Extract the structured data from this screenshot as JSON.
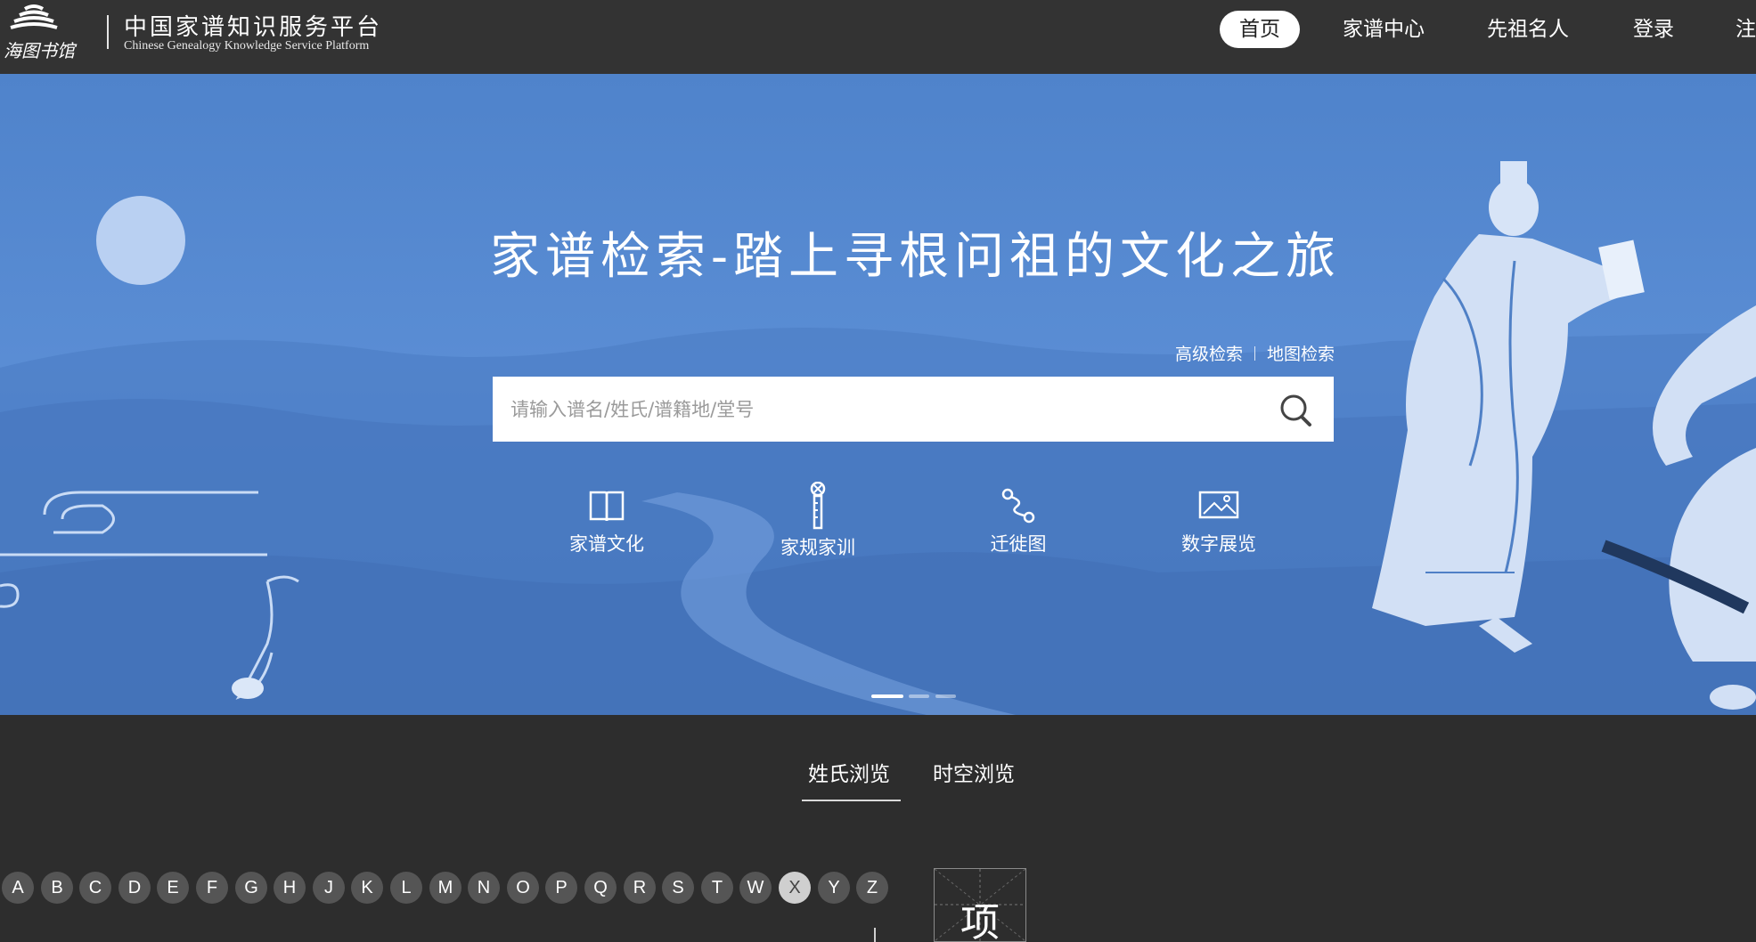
{
  "header": {
    "logo_text": "海图书馆",
    "site_title": "中国家谱知识服务平台",
    "site_subtitle": "Chinese Genealogy Knowledge Service Platform",
    "nav": [
      {
        "label": "首页",
        "active": true
      },
      {
        "label": "家谱中心"
      },
      {
        "label": "先祖名人"
      },
      {
        "label": "登录"
      },
      {
        "label": "注"
      }
    ]
  },
  "hero": {
    "title": "家谱检索-踏上寻根问祖的文化之旅",
    "advanced_search": "高级检索",
    "map_search": "地图检索",
    "search_placeholder": "请输入谱名/姓氏/谱籍地/堂号",
    "quick_links": [
      {
        "label": "家谱文化",
        "icon": "book-icon"
      },
      {
        "label": "家规家训",
        "icon": "scroll-icon"
      },
      {
        "label": "迁徙图",
        "icon": "route-icon"
      },
      {
        "label": "数字展览",
        "icon": "gallery-icon"
      }
    ],
    "carousel": {
      "slides": 3,
      "active": 1
    }
  },
  "browse": {
    "tabs": [
      {
        "label": "姓氏浏览",
        "active": true
      },
      {
        "label": "时空浏览"
      }
    ],
    "letters": [
      "A",
      "B",
      "C",
      "D",
      "E",
      "F",
      "G",
      "H",
      "J",
      "K",
      "L",
      "M",
      "N",
      "O",
      "P",
      "Q",
      "R",
      "S",
      "T",
      "W",
      "X",
      "Y",
      "Z"
    ],
    "selected_letter": "X",
    "surname_card": "项"
  },
  "colors": {
    "header_bg": "#333333",
    "hero_blue": "#5a8dd4",
    "page_bg": "#2d2d2d",
    "letter_bg": "#555555",
    "letter_selected_bg": "#cfcfcf"
  }
}
